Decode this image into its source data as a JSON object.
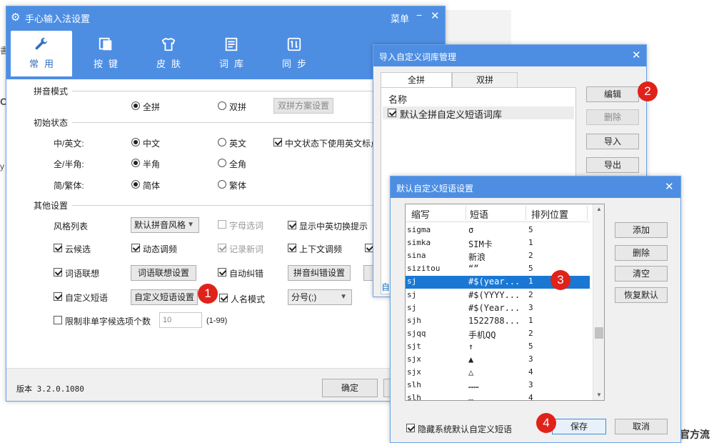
{
  "background": {
    "side_char_top": "書",
    "side_char_mid": "C",
    "side_char_low": "y",
    "footer_text": "官方流"
  },
  "main_window": {
    "title": "手心输入法设置",
    "menu_label": "菜单",
    "minimize_glyph": "−",
    "close_glyph": "✕",
    "tabs": [
      {
        "label": "常用",
        "icon": "wrench-icon"
      },
      {
        "label": "按键",
        "icon": "keys-icon"
      },
      {
        "label": "皮肤",
        "icon": "shirt-icon"
      },
      {
        "label": "词库",
        "icon": "document-icon"
      },
      {
        "label": "同步",
        "icon": "sync-icon"
      }
    ],
    "pinyin_mode": {
      "title": "拼音模式",
      "quanpin": "全拼",
      "shuangpin": "双拼",
      "scheme_button": "双拼方案设置"
    },
    "initial_state": {
      "title": "初始状态",
      "cn_en_label": "中/英文:",
      "cn": "中文",
      "en": "英文",
      "punct_check": "中文状态下使用英文标点",
      "width_label": "全/半角:",
      "half": "半角",
      "full": "全角",
      "script_label": "简/繁体:",
      "simplified": "简体",
      "traditional": "繁体"
    },
    "other": {
      "title": "其他设置",
      "style_label": "风格列表",
      "style_value": "默认拼音风格",
      "letter_select": "字母选词",
      "show_switch_tip": "显示中英切换提示",
      "cloud": "云候选",
      "dynamic_freq": "动态调频",
      "record_new": "记录新词",
      "context_freq": "上下文调频",
      "word_assoc": "词语联想",
      "word_assoc_btn": "词语联想设置",
      "auto_correct": "自动纠错",
      "pinyin_correct_btn": "拼音纠错设置",
      "custom_phrase": "自定义短语",
      "custom_phrase_btn": "自定义短语设置",
      "name_mode": "人名模式",
      "separator_value": "分号(;)",
      "limit_label": "限制非单字候选项个数",
      "limit_value": "10",
      "limit_range": "(1-99)"
    },
    "footer": {
      "version": "版本 3.2.0.1080",
      "ok": "确定"
    }
  },
  "import_dialog": {
    "title": "导入自定义词库管理",
    "close_glyph": "✕",
    "tab_quanpin": "全拼",
    "tab_shuangpin": "双拼",
    "list_header": "名称",
    "list_item": "默认全拼自定义短语词库",
    "buttons": {
      "edit": "编辑",
      "delete": "删除",
      "import": "导入",
      "export": "导出"
    },
    "peek_text": "自"
  },
  "phrase_dialog": {
    "title": "默认自定义短语设置",
    "close_glyph": "✕",
    "columns": [
      "缩写",
      "短语",
      "排列位置"
    ],
    "rows": [
      {
        "abbr": "sigma",
        "phrase": "σ",
        "pos": "5"
      },
      {
        "abbr": "simka",
        "phrase": "SIM卡",
        "pos": "1"
      },
      {
        "abbr": "sina",
        "phrase": "新浪",
        "pos": "2"
      },
      {
        "abbr": "sizitou",
        "phrase": "“”",
        "pos": "5"
      },
      {
        "abbr": "sj",
        "phrase": "#$(year...",
        "pos": "1"
      },
      {
        "abbr": "sj",
        "phrase": "#$(YYYY...",
        "pos": "2"
      },
      {
        "abbr": "sj",
        "phrase": "#$(Year...",
        "pos": "3"
      },
      {
        "abbr": "sjh",
        "phrase": "1522788...",
        "pos": "1"
      },
      {
        "abbr": "sjqq",
        "phrase": "手机QQ",
        "pos": "2"
      },
      {
        "abbr": "sjt",
        "phrase": "↑",
        "pos": "5"
      },
      {
        "abbr": "sjx",
        "phrase": "▲",
        "pos": "3"
      },
      {
        "abbr": "sjx",
        "phrase": "△",
        "pos": "4"
      },
      {
        "abbr": "slh",
        "phrase": "……",
        "pos": "3"
      },
      {
        "abbr": "slh",
        "phrase": "…",
        "pos": "4"
      }
    ],
    "selected_index": 4,
    "buttons": {
      "add": "添加",
      "delete": "删除",
      "clear": "清空",
      "restore": "恢复默认"
    },
    "hide_system": "隐藏系统默认自定义短语",
    "save": "保存",
    "cancel": "取消"
  },
  "callouts": [
    "1",
    "2",
    "3",
    "4"
  ],
  "colors": {
    "titlebar": "#4d8ee3",
    "selection": "#1a78d4",
    "callout": "#e0221a"
  }
}
